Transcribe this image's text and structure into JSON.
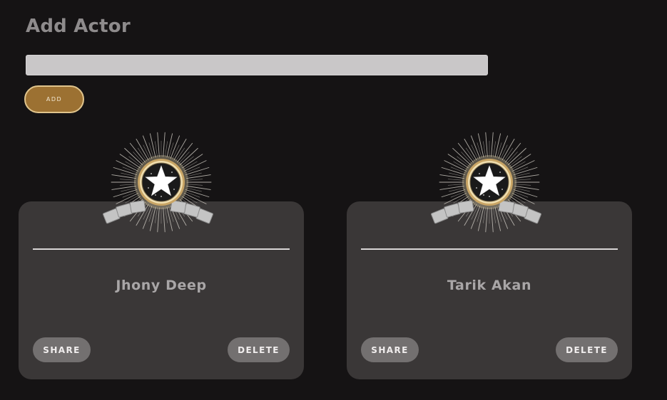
{
  "page": {
    "title": "Add Actor"
  },
  "form": {
    "input_value": "",
    "add_label": "ADD"
  },
  "actors": [
    {
      "name": "Jhony Deep",
      "share_label": "SHARE",
      "delete_label": "DELETE",
      "badge_icon": "star-award-icon"
    },
    {
      "name": "Tarik Akan",
      "share_label": "SHARE",
      "delete_label": "DELETE",
      "badge_icon": "star-award-icon"
    }
  ],
  "colors": {
    "background": "#151314",
    "card": "#3a3737",
    "accent_gold": "#9c7132",
    "button_grey": "#737070",
    "title_text": "#8e8b8c"
  }
}
